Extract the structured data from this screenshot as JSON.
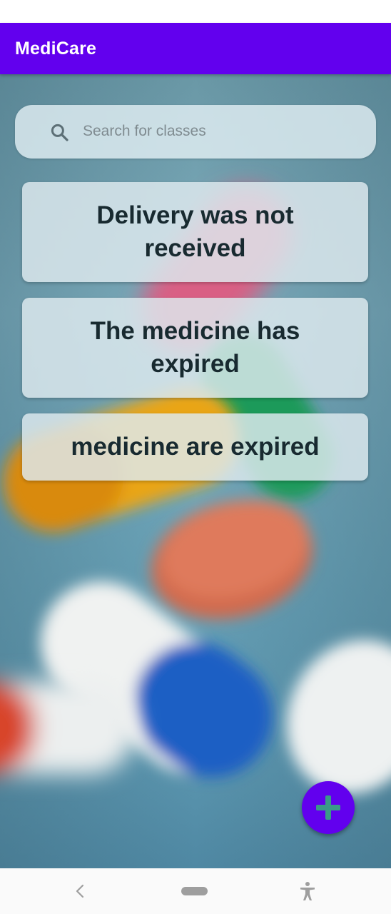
{
  "app": {
    "title": "MediCare",
    "accent_color": "#6200ee"
  },
  "search": {
    "placeholder": "Search for classes",
    "icon": "search-icon"
  },
  "classes": [
    {
      "label": "Delivery was not received"
    },
    {
      "label": "The medicine has expired"
    },
    {
      "label": "medicine are expired"
    }
  ],
  "fab": {
    "icon": "plus-icon",
    "icon_color": "#3a9a88"
  },
  "nav_bar": {
    "back_icon": "chevron-left-icon",
    "home_icon": "home-pill-icon",
    "accessibility_icon": "accessibility-icon"
  }
}
